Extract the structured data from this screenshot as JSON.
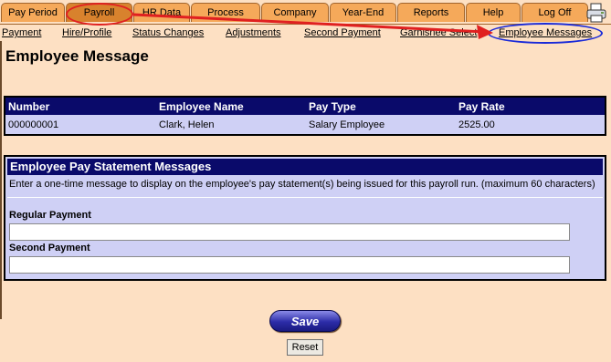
{
  "tabs": [
    {
      "label": "Pay Period"
    },
    {
      "label": "Payroll"
    },
    {
      "label": "HR Data"
    },
    {
      "label": "Process"
    },
    {
      "label": "Company"
    },
    {
      "label": "Year-End"
    },
    {
      "label": "Reports"
    },
    {
      "label": "Help"
    },
    {
      "label": "Log Off"
    }
  ],
  "active_tab": "Payroll",
  "subnav": [
    {
      "label": "Payment"
    },
    {
      "label": "Hire/Profile"
    },
    {
      "label": "Status Changes"
    },
    {
      "label": "Adjustments"
    },
    {
      "label": "Second Payment"
    },
    {
      "label": "Garnishee Select"
    },
    {
      "label": "Employee Messages"
    }
  ],
  "page_title": "Employee Message",
  "employee_table": {
    "headers": [
      "Number",
      "Employee Name",
      "Pay Type",
      "Pay Rate"
    ],
    "row": [
      "000000001",
      "Clark, Helen",
      "Salary Employee",
      "2525.00"
    ]
  },
  "messages": {
    "title": "Employee Pay Statement Messages",
    "instruction": "Enter a one-time message to display on the employee's pay statement(s) being issued for this payroll run. (maximum 60 characters)",
    "regular_label": "Regular Payment",
    "regular_value": "",
    "second_label": "Second Payment",
    "second_value": ""
  },
  "buttons": {
    "save": "Save",
    "reset": "Reset"
  },
  "colors": {
    "background": "#fde0c3",
    "tab": "#f5a95a",
    "tab_active": "#d8822d",
    "header_navy": "#0a0a6a",
    "panel": "#cfd0f5",
    "annotation_red": "#e02020",
    "annotation_blue": "#1a2ad8"
  }
}
